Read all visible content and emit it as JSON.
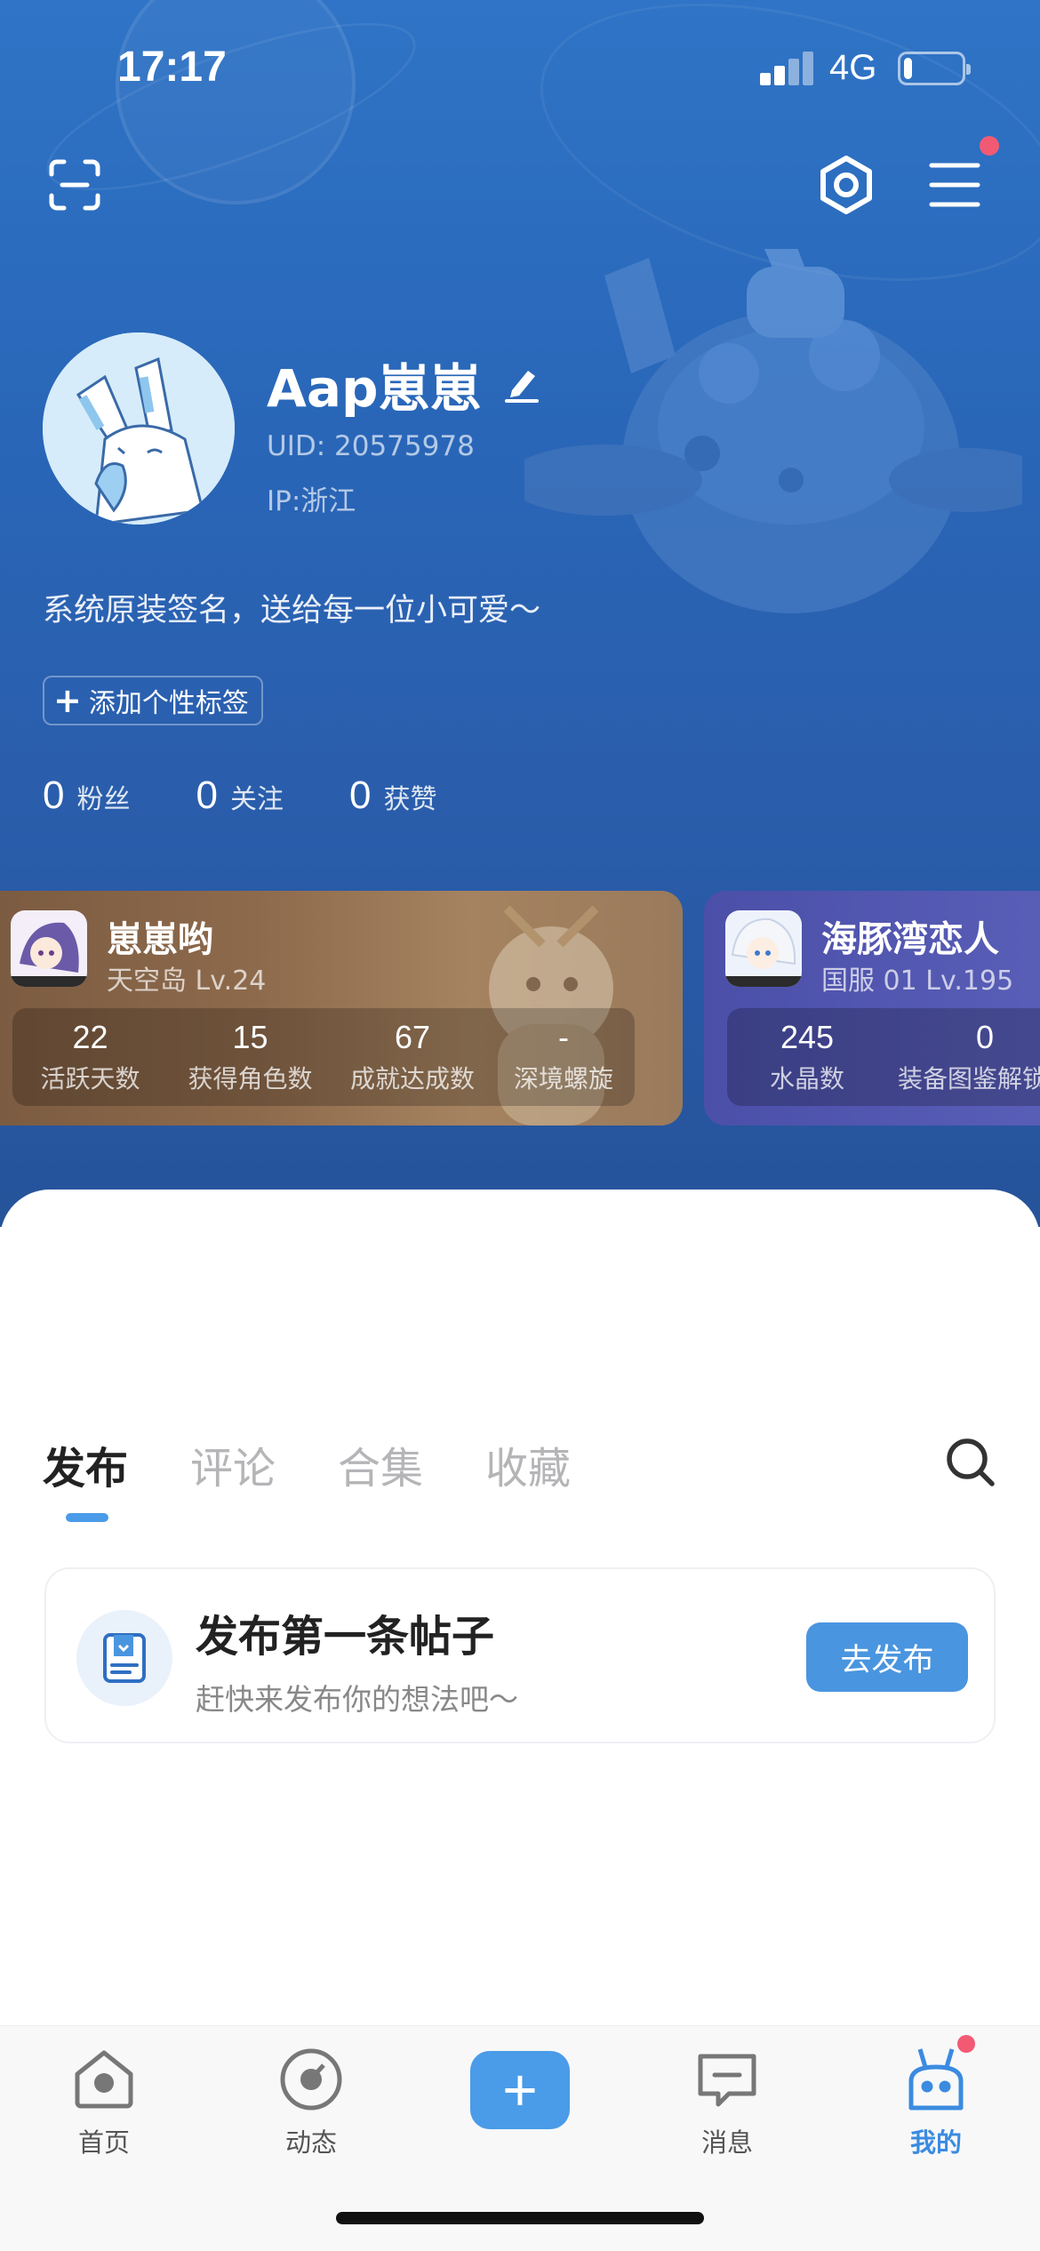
{
  "status_bar": {
    "time": "17:17",
    "network": "4G",
    "battery_level": 0.15
  },
  "profile": {
    "username": "Aap崽崽",
    "uid": "UID: 20575978",
    "ip": "IP:浙江",
    "signature": "系统原装签名，送给每一位小可爱～",
    "add_tag_label": "添加个性标签"
  },
  "stats": [
    {
      "num": "0",
      "label": "粉丝"
    },
    {
      "num": "0",
      "label": "关注"
    },
    {
      "num": "0",
      "label": "获赞"
    }
  ],
  "game_cards": [
    {
      "title": "崽崽哟",
      "subtitle": "天空岛 Lv.24",
      "stats": [
        {
          "value": "22",
          "label": "活跃天数"
        },
        {
          "value": "15",
          "label": "获得角色数"
        },
        {
          "value": "67",
          "label": "成就达成数"
        },
        {
          "value": "-",
          "label": "深境螺旋"
        }
      ]
    },
    {
      "title": "海豚湾恋人",
      "subtitle": "国服 01 Lv.195",
      "stats": [
        {
          "value": "245",
          "label": "水晶数"
        },
        {
          "value": "0",
          "label": "装备图鉴解锁数"
        }
      ]
    }
  ],
  "content_tabs": [
    "发布",
    "评论",
    "合集",
    "收藏"
  ],
  "empty_post": {
    "title": "发布第一条帖子",
    "subtitle": "赶快来发布你的想法吧～",
    "button_label": "去发布"
  },
  "tabbar": {
    "items": [
      {
        "label": "首页",
        "icon": "home-icon"
      },
      {
        "label": "动态",
        "icon": "compass-icon"
      },
      {
        "label": "",
        "icon": "plus-icon"
      },
      {
        "label": "消息",
        "icon": "message-icon"
      },
      {
        "label": "我的",
        "icon": "profile-icon"
      }
    ]
  },
  "colors": {
    "accent": "#4a9be8",
    "hero_bg": "#2a66b6",
    "notification": "#f25a74"
  }
}
